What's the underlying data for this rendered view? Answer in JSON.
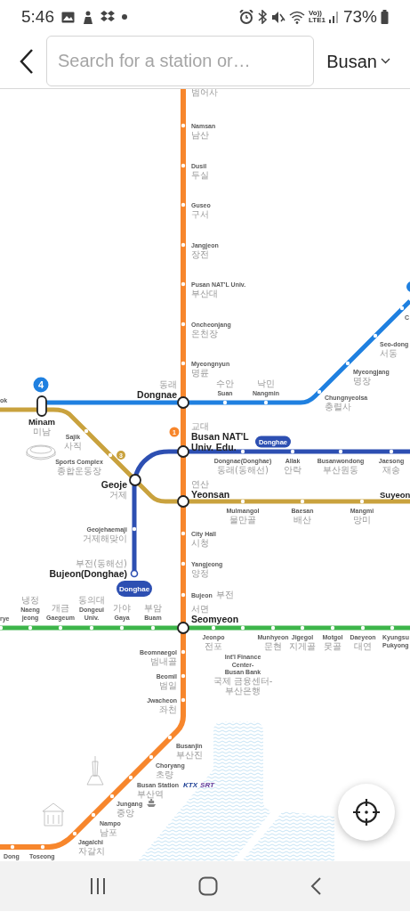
{
  "status_bar": {
    "time": "5:46",
    "network": [
      "Vo))",
      "LTE1"
    ],
    "battery": "73%"
  },
  "header": {
    "search": {
      "placeholder": "Search for a station or…"
    },
    "city": "Busan"
  },
  "map": {
    "lines": [
      {
        "color": "#f7862c"
      },
      {
        "color": "#1f80e0"
      },
      {
        "color": "#c9a23e"
      },
      {
        "color": "#2d4fb2"
      },
      {
        "color": "#3db54a"
      }
    ],
    "line_badges": [
      {
        "label": "4",
        "color": "#1f80e0"
      },
      {
        "label": "1",
        "color": "#f7862c"
      },
      {
        "label": "3",
        "color": "#c9a23e"
      },
      {
        "label": "Donghae",
        "color": "#2d4fb2"
      },
      {
        "label": "Donghae",
        "color": "#2d4fb2"
      }
    ],
    "stations": [
      {
        "name_ko": [
          "범어사"
        ],
        "kind": "offmap"
      },
      {
        "name": [
          "Namsan"
        ],
        "name_ko": [
          "남산"
        ],
        "kind": "stop"
      },
      {
        "name": [
          "Dusil"
        ],
        "name_ko": [
          "두실"
        ],
        "kind": "stop"
      },
      {
        "name": [
          "Guseo"
        ],
        "name_ko": [
          "구서"
        ],
        "kind": "stop"
      },
      {
        "name": [
          "Jangjeon"
        ],
        "name_ko": [
          "장전"
        ],
        "kind": "stop"
      },
      {
        "name": [
          "Pusan NAT'L Univ."
        ],
        "name_ko": [
          "부산대"
        ],
        "kind": "stop"
      },
      {
        "name": [
          "Oncheonjang"
        ],
        "name_ko": [
          "온천장"
        ],
        "kind": "stop"
      },
      {
        "name": [
          "Myeongnyun"
        ],
        "name_ko": [
          "명륜"
        ],
        "kind": "stop"
      },
      {
        "name": [
          "C"
        ],
        "kind": "stop"
      },
      {
        "name": [
          "Seo-dong"
        ],
        "name_ko": [
          "서동"
        ],
        "kind": "stop"
      },
      {
        "name": [
          "Myeongjang"
        ],
        "name_ko": [
          "명장"
        ],
        "kind": "stop"
      },
      {
        "name": [
          "Chungnyeolsa"
        ],
        "name_ko": [
          "충렬사"
        ],
        "kind": "stop"
      },
      {
        "name": [
          "Dongnae"
        ],
        "name_ko": [
          "동래"
        ],
        "kind": "transfer"
      },
      {
        "name": [
          "Suan"
        ],
        "name_ko": [
          "수안"
        ],
        "kind": "stop"
      },
      {
        "name": [
          "Nangmin"
        ],
        "name_ko": [
          "낙민"
        ],
        "kind": "stop"
      },
      {
        "name": [
          "ok"
        ],
        "kind": "offmap"
      },
      {
        "name": [
          "Minam"
        ],
        "name_ko": [
          "미남"
        ],
        "kind": "pill"
      },
      {
        "name": [
          "Sajik"
        ],
        "name_ko": [
          "사직"
        ],
        "kind": "stop"
      },
      {
        "name": [
          "Busan NAT'L",
          "Univ. Edu."
        ],
        "name_ko": [
          "교대"
        ],
        "kind": "transfer"
      },
      {
        "name": [
          "Sports Complex"
        ],
        "name_ko": [
          "종합운동장"
        ],
        "kind": "stop"
      },
      {
        "name": [
          "Dongnae(Donghae)"
        ],
        "name_ko": [
          "동래(동해선)"
        ],
        "kind": "stop"
      },
      {
        "name": [
          "Allak"
        ],
        "name_ko": [
          "안락"
        ],
        "kind": "stop"
      },
      {
        "name": [
          "Busanwondong"
        ],
        "name_ko": [
          "부산원동"
        ],
        "kind": "stop"
      },
      {
        "name": [
          "Jaesong"
        ],
        "name_ko": [
          "재송"
        ],
        "kind": "stop"
      },
      {
        "name": [
          "Geoje"
        ],
        "name_ko": [
          "거제"
        ],
        "kind": "transfer"
      },
      {
        "name": [
          "Yeonsan"
        ],
        "name_ko": [
          "연산"
        ],
        "kind": "transfer"
      },
      {
        "name": [
          "Suyeon"
        ],
        "kind": "edge_transfer"
      },
      {
        "name": [
          "Mulmangol"
        ],
        "name_ko": [
          "물만골"
        ],
        "kind": "stop"
      },
      {
        "name": [
          "Baesan"
        ],
        "name_ko": [
          "배산"
        ],
        "kind": "stop"
      },
      {
        "name": [
          "Mangmi"
        ],
        "name_ko": [
          "망미"
        ],
        "kind": "stop"
      },
      {
        "name": [
          "Geojehaemaji"
        ],
        "name_ko": [
          "거제해맞이"
        ],
        "kind": "stop"
      },
      {
        "name": [
          "City Hall"
        ],
        "name_ko": [
          "시청"
        ],
        "kind": "stop"
      },
      {
        "name": [
          "Bujeon(Donghae)"
        ],
        "name_ko": [
          "부전(동해선)"
        ],
        "kind": "terminal"
      },
      {
        "name": [
          "Yangjeong"
        ],
        "name_ko": [
          "양정"
        ],
        "kind": "stop"
      },
      {
        "name": [
          "Bujeon"
        ],
        "name_ko": [
          "부전"
        ],
        "kind": "stop"
      },
      {
        "name": [
          "rye"
        ],
        "kind": "stop"
      },
      {
        "name": [
          "Naeng",
          "jeong"
        ],
        "name_ko": [
          "냉정"
        ],
        "kind": "stop"
      },
      {
        "name": [
          "Gaegeum"
        ],
        "name_ko": [
          "개금"
        ],
        "kind": "stop"
      },
      {
        "name": [
          "Dongeui",
          "Univ."
        ],
        "name_ko": [
          "동의대"
        ],
        "kind": "stop"
      },
      {
        "name": [
          "Gaya"
        ],
        "name_ko": [
          "가야"
        ],
        "kind": "stop"
      },
      {
        "name": [
          "Buam"
        ],
        "name_ko": [
          "부암"
        ],
        "kind": "stop"
      },
      {
        "name": [
          "Seomyeon"
        ],
        "name_ko": [
          "서면"
        ],
        "kind": "transfer"
      },
      {
        "name": [
          "Jeonpo"
        ],
        "name_ko": [
          "전포"
        ],
        "kind": "stop"
      },
      {
        "name": [
          "Int'l Finance",
          "Center-",
          "Busan Bank"
        ],
        "name_ko": [
          "국제 금융센터-",
          "부산은행"
        ],
        "kind": "stop"
      },
      {
        "name": [
          "Munhyeon"
        ],
        "name_ko": [
          "문현"
        ],
        "kind": "stop"
      },
      {
        "name": [
          "Jigegol"
        ],
        "name_ko": [
          "지게골"
        ],
        "kind": "stop"
      },
      {
        "name": [
          "Motgol"
        ],
        "name_ko": [
          "못골"
        ],
        "kind": "stop"
      },
      {
        "name": [
          "Daeyeon"
        ],
        "name_ko": [
          "대연"
        ],
        "kind": "stop"
      },
      {
        "name": [
          "Kyungsu",
          "Pukyong"
        ],
        "kind": "stop"
      },
      {
        "name": [
          "Beomnaegol"
        ],
        "name_ko": [
          "범내골"
        ],
        "kind": "stop"
      },
      {
        "name": [
          "Beomil"
        ],
        "name_ko": [
          "범일"
        ],
        "kind": "stop"
      },
      {
        "name": [
          "Jwacheon"
        ],
        "name_ko": [
          "좌천"
        ],
        "kind": "stop"
      },
      {
        "name": [
          "Busanjin"
        ],
        "name_ko": [
          "부산진"
        ],
        "kind": "stop"
      },
      {
        "name": [
          "Choryang"
        ],
        "name_ko": [
          "초량"
        ],
        "kind": "stop"
      },
      {
        "name": [
          "Busan Station"
        ],
        "name_ko": [
          "부산역"
        ],
        "kind": "stop",
        "rail_logos": [
          "KTX",
          "SRT"
        ]
      },
      {
        "name": [
          "Jungang"
        ],
        "name_ko": [
          "중앙"
        ],
        "kind": "stop"
      },
      {
        "name": [
          "Nampo"
        ],
        "name_ko": [
          "남포"
        ],
        "kind": "stop"
      },
      {
        "name": [
          "Jagalchi"
        ],
        "name_ko": [
          "자갈치"
        ],
        "kind": "stop"
      },
      {
        "name": [
          "Toseong"
        ],
        "kind": "stop"
      },
      {
        "name": [
          "Dong"
        ],
        "kind": "stop"
      }
    ]
  }
}
